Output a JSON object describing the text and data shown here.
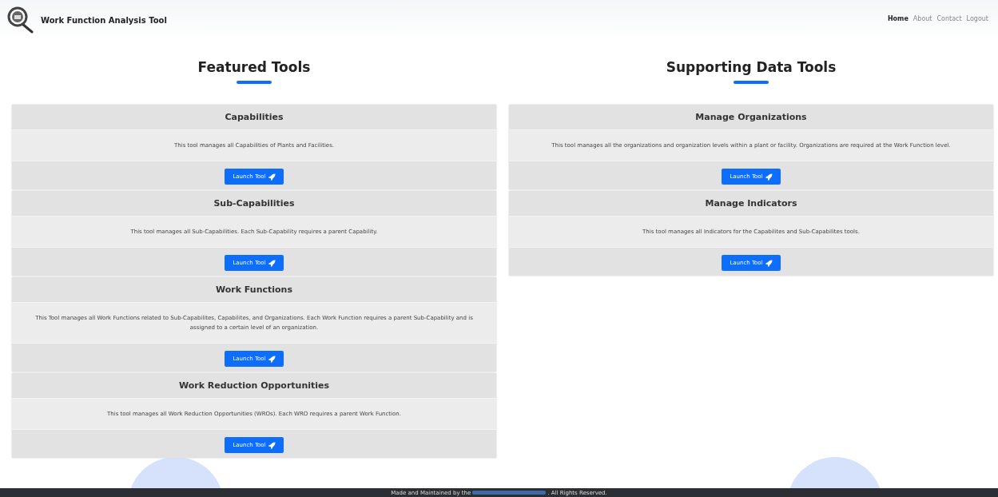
{
  "brand": {
    "title": "Work Function Analysis Tool"
  },
  "nav": [
    {
      "label": "Home",
      "selected": true
    },
    {
      "label": "About",
      "selected": false
    },
    {
      "label": "Contact",
      "selected": false
    },
    {
      "label": "Logout",
      "selected": false
    }
  ],
  "sections": [
    {
      "heading": "Featured Tools",
      "tools": [
        {
          "title": "Capabilities",
          "description": "This tool manages all Capabilities of Plants and Facilities.",
          "button": "Launch Tool"
        },
        {
          "title": "Sub-Capabilities",
          "description": "This tool manages all Sub-Capabilities. Each Sub-Capability requires a parent Capability.",
          "button": "Launch Tool"
        },
        {
          "title": "Work Functions",
          "description": "This Tool manages all Work Functions related to Sub-Capabilites, Capabilites, and Organizations. Each Work Function requires a parent Sub-Capability and is assigned to a certain level of an organization.",
          "button": "Launch Tool"
        },
        {
          "title": "Work Reduction Opportunities",
          "description": "This tool manages all Work Reduction Opportunities (WROs). Each WRO requires a parent Work Function.",
          "button": "Launch Tool"
        }
      ]
    },
    {
      "heading": "Supporting Data Tools",
      "tools": [
        {
          "title": "Manage Organizations",
          "description": "This tool manages all the organizations and organization levels within a plant or facility. Organizations are required at the Work Function level.",
          "button": "Launch Tool"
        },
        {
          "title": "Manage Indicators",
          "description": "This tool manages all Indicators for the Capabilites and Sub-Capabilites tools.",
          "button": "Launch Tool"
        }
      ]
    }
  ],
  "footer": {
    "before": "Made and Maintained by the",
    "after": ". All Rights Reserved."
  }
}
